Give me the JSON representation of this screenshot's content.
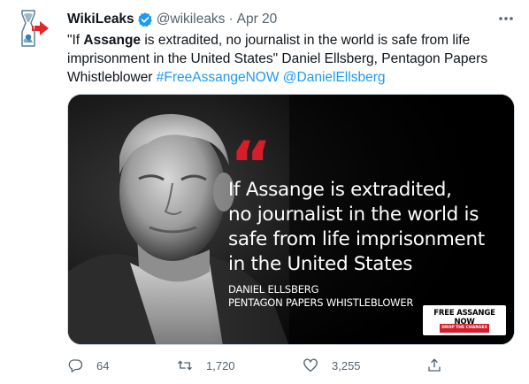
{
  "author": {
    "name": "WikiLeaks",
    "handle": "@wikileaks",
    "separator": "·",
    "date": "Apr 20",
    "verified_color": "#1d9bf0",
    "avatar_icon": "wikileaks-hourglass-logo"
  },
  "tweet": {
    "open_quote": "\"If ",
    "bold_word": "Assange",
    "rest": " is extradited, no journalist in the world is safe from life imprisonment in the United States\" Daniel Ellsberg, Pentagon Papers Whistleblower ",
    "hashtag": "#FreeAssangeNOW",
    "space": " ",
    "mention": "@DanielEllsberg",
    "link_color": "#1d9bf0"
  },
  "media": {
    "quote_mark": "“",
    "quote_lines": [
      "If Assange is extradited,",
      "no journalist in the world is",
      "safe from life imprisonment",
      "in the United States"
    ],
    "credit_name": "DANIEL ELLSBERG",
    "credit_title": "PENTAGON PAPERS WHISTLEBLOWER",
    "badge_title": "FREE ASSANGE NOW",
    "badge_sub": "DROP THE CHARGES",
    "accent_color": "#d51e2a"
  },
  "actions": {
    "replies": "64",
    "retweets": "1,720",
    "likes": "3,255",
    "icons": [
      "reply-icon",
      "retweet-icon",
      "like-icon",
      "share-icon"
    ]
  }
}
